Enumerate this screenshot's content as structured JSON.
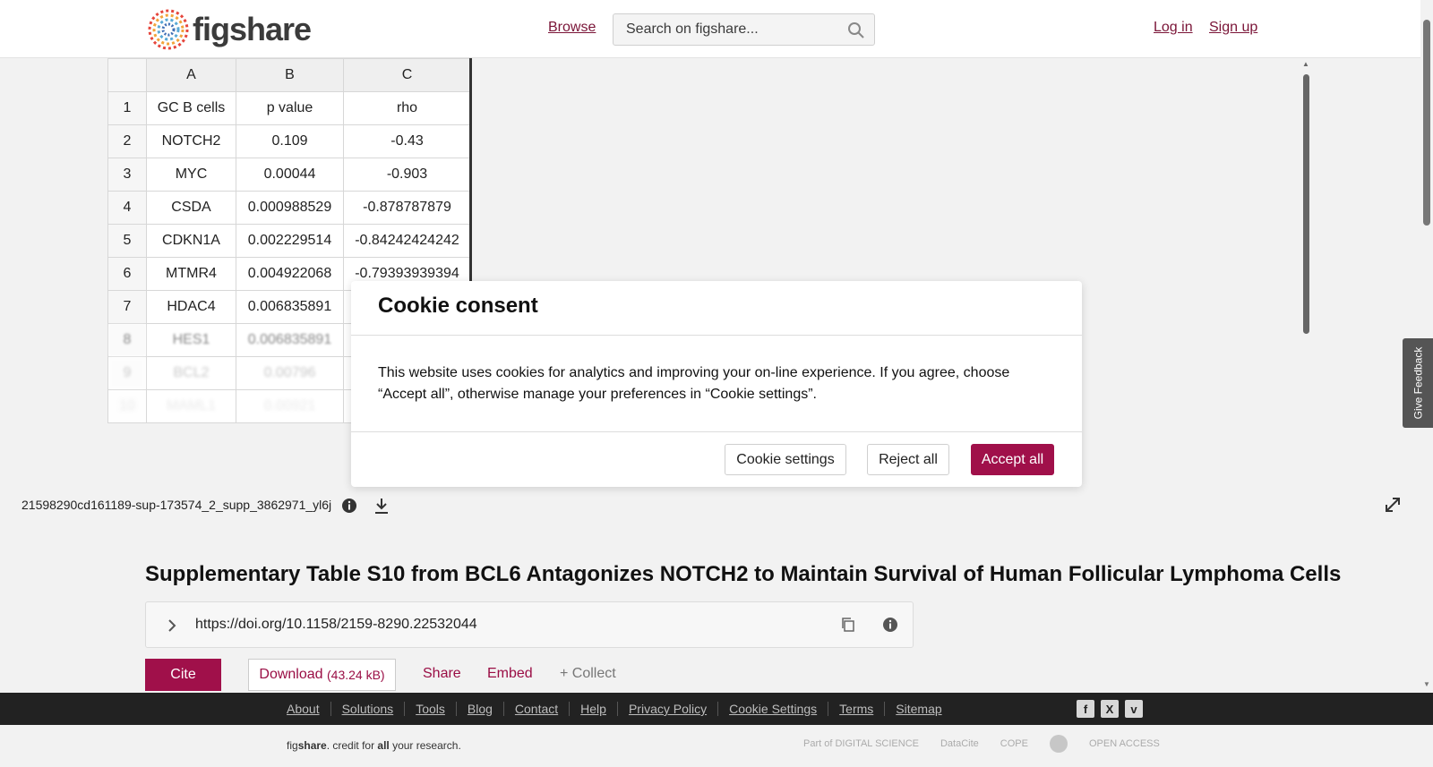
{
  "header": {
    "logo_text": "figshare",
    "browse_label": "Browse",
    "search_placeholder": "Search on figshare...",
    "login_label": "Log in",
    "signup_label": "Sign up"
  },
  "sheet": {
    "columns": [
      "A",
      "B",
      "C"
    ],
    "rows": [
      {
        "n": "1",
        "a": "GC B cells",
        "b": "p value",
        "c": "rho"
      },
      {
        "n": "2",
        "a": "NOTCH2",
        "b": "0.109",
        "c": "-0.43"
      },
      {
        "n": "3",
        "a": "MYC",
        "b": "0.00044",
        "c": "-0.903"
      },
      {
        "n": "4",
        "a": "CSDA",
        "b": "0.000988529",
        "c": "-0.878787879"
      },
      {
        "n": "5",
        "a": "CDKN1A",
        "b": "0.002229514",
        "c": "-0.84242424242"
      },
      {
        "n": "6",
        "a": "MTMR4",
        "b": "0.004922068",
        "c": "-0.79393939394"
      },
      {
        "n": "7",
        "a": "HDAC4",
        "b": "0.006835891",
        "c": ""
      },
      {
        "n": "8",
        "a": "HES1",
        "b": "0.006835891",
        "c": ""
      },
      {
        "n": "9",
        "a": "BCL2",
        "b": "0.00796",
        "c": ""
      },
      {
        "n": "10",
        "a": "MAML1",
        "b": "0.00921",
        "c": ""
      }
    ]
  },
  "feedback_label": "Give Feedback",
  "viewer": {
    "filename": "21598290cd161189-sup-173574_2_supp_3862971_yl6j"
  },
  "item": {
    "title": "Supplementary Table S10 from BCL6 Antagonizes NOTCH2 to Maintain Survival of Human Follicular Lymphoma Cells",
    "doi": "https://doi.org/10.1158/2159-8290.22532044",
    "cite_label": "Cite",
    "download_label": "Download",
    "download_size": "(43.24 kB)",
    "share_label": "Share",
    "embed_label": "Embed",
    "collect_label": "+ Collect"
  },
  "footer": {
    "links": [
      "About",
      "Solutions",
      "Tools",
      "Blog",
      "Contact",
      "Help",
      "Privacy Policy",
      "Cookie Settings",
      "Terms",
      "Sitemap"
    ],
    "tagline_pre": "fig",
    "tagline_brand": "share",
    "tagline_mid": ". credit for ",
    "tagline_all": "all",
    "tagline_post": " your research.",
    "partners": [
      "Part of DIGITAL SCIENCE",
      "DataCite",
      "COPE",
      "",
      "OPEN ACCESS"
    ]
  },
  "cookie": {
    "title": "Cookie consent",
    "body": "This website uses cookies for analytics and improving your on-line experience. If you agree, choose “Accept all”, otherwise manage your preferences in “Cookie settings”.",
    "settings_label": "Cookie settings",
    "reject_label": "Reject all",
    "accept_label": "Accept all"
  },
  "colors": {
    "brand": "#a0104a",
    "link": "#7a1437",
    "footer_bg": "#222222"
  }
}
